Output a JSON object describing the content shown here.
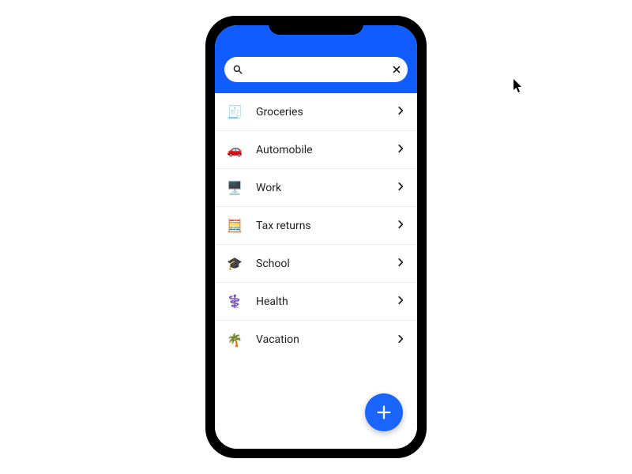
{
  "search": {
    "value": "",
    "placeholder": ""
  },
  "categories": [
    {
      "id": "groceries",
      "label": "Groceries",
      "icon": "groceries-icon",
      "tint": "tint-green"
    },
    {
      "id": "automobile",
      "label": "Automobile",
      "icon": "car-icon",
      "tint": "tint-red"
    },
    {
      "id": "work",
      "label": "Work",
      "icon": "work-icon",
      "tint": "tint-blue"
    },
    {
      "id": "tax",
      "label": "Tax returns",
      "icon": "tax-icon",
      "tint": "tint-orange"
    },
    {
      "id": "school",
      "label": "School",
      "icon": "school-icon",
      "tint": "tint-purple"
    },
    {
      "id": "health",
      "label": "Health",
      "icon": "health-icon",
      "tint": "tint-navy"
    },
    {
      "id": "vacation",
      "label": "Vacation",
      "icon": "vacation-icon",
      "tint": "tint-brown"
    }
  ],
  "icon_glyphs": {
    "groceries-icon": "🧾",
    "car-icon": "🚗",
    "work-icon": "🖥️",
    "tax-icon": "🧮",
    "school-icon": "🎓",
    "health-icon": "⚕️",
    "vacation-icon": "🌴"
  },
  "fab": {
    "action": "add"
  },
  "colors": {
    "header_bg": "#115cff",
    "fab_bg": "#1b65ff"
  }
}
